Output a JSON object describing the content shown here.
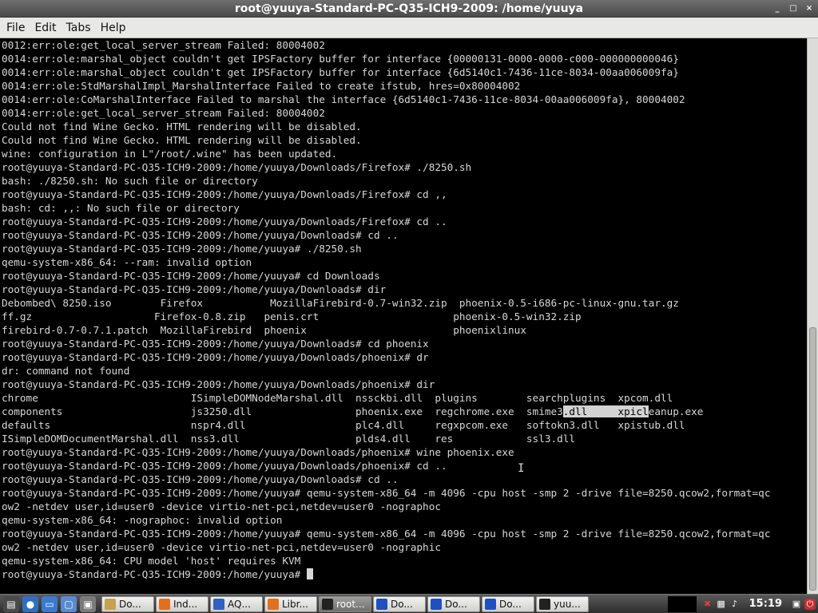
{
  "window": {
    "title": "root@yuuya-Standard-PC-Q35-ICH9-2009: /home/yuuya",
    "controls": [
      "_",
      "□",
      "×"
    ]
  },
  "menu": [
    {
      "label": "File"
    },
    {
      "label": "Edit"
    },
    {
      "label": "Tabs"
    },
    {
      "label": "Help"
    }
  ],
  "terminal": {
    "lines": [
      "0012:err:ole:get_local_server_stream Failed: 80004002",
      "0014:err:ole:marshal_object couldn't get IPSFactory buffer for interface {00000131-0000-0000-c000-000000000046}",
      "0014:err:ole:marshal_object couldn't get IPSFactory buffer for interface {6d5140c1-7436-11ce-8034-00aa006009fa}",
      "0014:err:ole:StdMarshalImpl_MarshalInterface Failed to create ifstub, hres=0x80004002",
      "0014:err:ole:CoMarshalInterface Failed to marshal the interface {6d5140c1-7436-11ce-8034-00aa006009fa}, 80004002",
      "0014:err:ole:get_local_server_stream Failed: 80004002",
      "Could not find Wine Gecko. HTML rendering will be disabled.",
      "Could not find Wine Gecko. HTML rendering will be disabled.",
      "wine: configuration in L\"/root/.wine\" has been updated.",
      "root@yuuya-Standard-PC-Q35-ICH9-2009:/home/yuuya/Downloads/Firefox# ./8250.sh",
      "bash: ./8250.sh: No such file or directory",
      "root@yuuya-Standard-PC-Q35-ICH9-2009:/home/yuuya/Downloads/Firefox# cd ,,",
      "bash: cd: ,,: No such file or directory",
      "root@yuuya-Standard-PC-Q35-ICH9-2009:/home/yuuya/Downloads/Firefox# cd ..",
      "root@yuuya-Standard-PC-Q35-ICH9-2009:/home/yuuya/Downloads# cd ..",
      "root@yuuya-Standard-PC-Q35-ICH9-2009:/home/yuuya# ./8250.sh",
      "qemu-system-x86_64: --ram: invalid option",
      "root@yuuya-Standard-PC-Q35-ICH9-2009:/home/yuuya# cd Downloads",
      "root@yuuya-Standard-PC-Q35-ICH9-2009:/home/yuuya/Downloads# dir",
      "Debombed\\ 8250.iso        Firefox           MozillaFirebird-0.7-win32.zip  phoenix-0.5-i686-pc-linux-gnu.tar.gz",
      "ff.gz                    Firefox-0.8.zip   penis.crt                      phoenix-0.5-win32.zip",
      "firebird-0.7-0.7.1.patch  MozillaFirebird  phoenix                        phoenixlinux",
      "root@yuuya-Standard-PC-Q35-ICH9-2009:/home/yuuya/Downloads# cd phoenix",
      "root@yuuya-Standard-PC-Q35-ICH9-2009:/home/yuuya/Downloads/phoenix# dr",
      "dr: command not found",
      "root@yuuya-Standard-PC-Q35-ICH9-2009:/home/yuuya/Downloads/phoenix# dir",
      "chrome                         ISimpleDOMNodeMarshal.dll  nssckbi.dll  plugins        searchplugins  xpcom.dll",
      "components                     js3250.dll                 phoenix.exe  regchrome.exe  smime3.dll     xpicleanup.exe",
      "defaults                       nspr4.dll                  plc4.dll     regxpcom.exe   softokn3.dll   xpistub.dll",
      "ISimpleDOMDocumentMarshal.dll  nss3.dll                   plds4.dll    res            ssl3.dll",
      "root@yuuya-Standard-PC-Q35-ICH9-2009:/home/yuuya/Downloads/phoenix# wine phoenix.exe",
      "root@yuuya-Standard-PC-Q35-ICH9-2009:/home/yuuya/Downloads/phoenix# cd ..",
      "root@yuuya-Standard-PC-Q35-ICH9-2009:/home/yuuya/Downloads# cd ..",
      "root@yuuya-Standard-PC-Q35-ICH9-2009:/home/yuuya# qemu-system-x86_64 -m 4096 -cpu host -smp 2 -drive file=8250.qcow2,format=qc",
      "ow2 -netdev user,id=user0 -device virtio-net-pci,netdev=user0 -nographoc",
      "qemu-system-x86_64: -nographoc: invalid option",
      "root@yuuya-Standard-PC-Q35-ICH9-2009:/home/yuuya# qemu-system-x86_64 -m 4096 -cpu host -smp 2 -drive file=8250.qcow2,format=qc",
      "ow2 -netdev user,id=user0 -device virtio-net-pci,netdev=user0 -nographic",
      "qemu-system-x86_64: CPU model 'host' requires KVM",
      "root@yuuya-Standard-PC-Q35-ICH9-2009:/home/yuuya# "
    ],
    "selection": {
      "line": 27,
      "text": ".dll     xpicl"
    },
    "colors": {
      "background": "#000000",
      "foreground": "#d7d7d7"
    }
  },
  "taskbar": {
    "launchers": [
      {
        "icon": "menu-icon"
      },
      {
        "icon": "network-icon"
      },
      {
        "icon": "files-icon"
      },
      {
        "icon": "window-icon"
      },
      {
        "icon": "terminal-launcher-icon"
      }
    ],
    "tasks": [
      {
        "label": "Do...",
        "icon": "folder-icon",
        "color": "#c8a050"
      },
      {
        "label": "Ind...",
        "icon": "firefox-icon",
        "color": "#e07020"
      },
      {
        "label": "AQ...",
        "icon": "browser-icon",
        "color": "#3060c0"
      },
      {
        "label": "Libr...",
        "icon": "firefox-icon",
        "color": "#e07020"
      },
      {
        "label": "root...",
        "icon": "terminal-icon",
        "color": "#222222",
        "active": true
      },
      {
        "label": "Do...",
        "icon": "document-icon",
        "color": "#2050c0"
      },
      {
        "label": "Do...",
        "icon": "document-icon",
        "color": "#2050c0"
      },
      {
        "label": "Do...",
        "icon": "document-icon",
        "color": "#2050c0"
      },
      {
        "label": "yuu...",
        "icon": "terminal-icon",
        "color": "#222222"
      }
    ],
    "tray": [
      {
        "icon": "close-tray-icon",
        "glyph": "✖"
      },
      {
        "icon": "network-tray-icon",
        "glyph": "▦"
      },
      {
        "icon": "volume-icon",
        "glyph": "♪"
      }
    ],
    "clock": "15:19",
    "end_icons": [
      {
        "icon": "monitor-icon",
        "glyph": "▣"
      },
      {
        "icon": "power-icon",
        "glyph": "⏻"
      }
    ]
  }
}
